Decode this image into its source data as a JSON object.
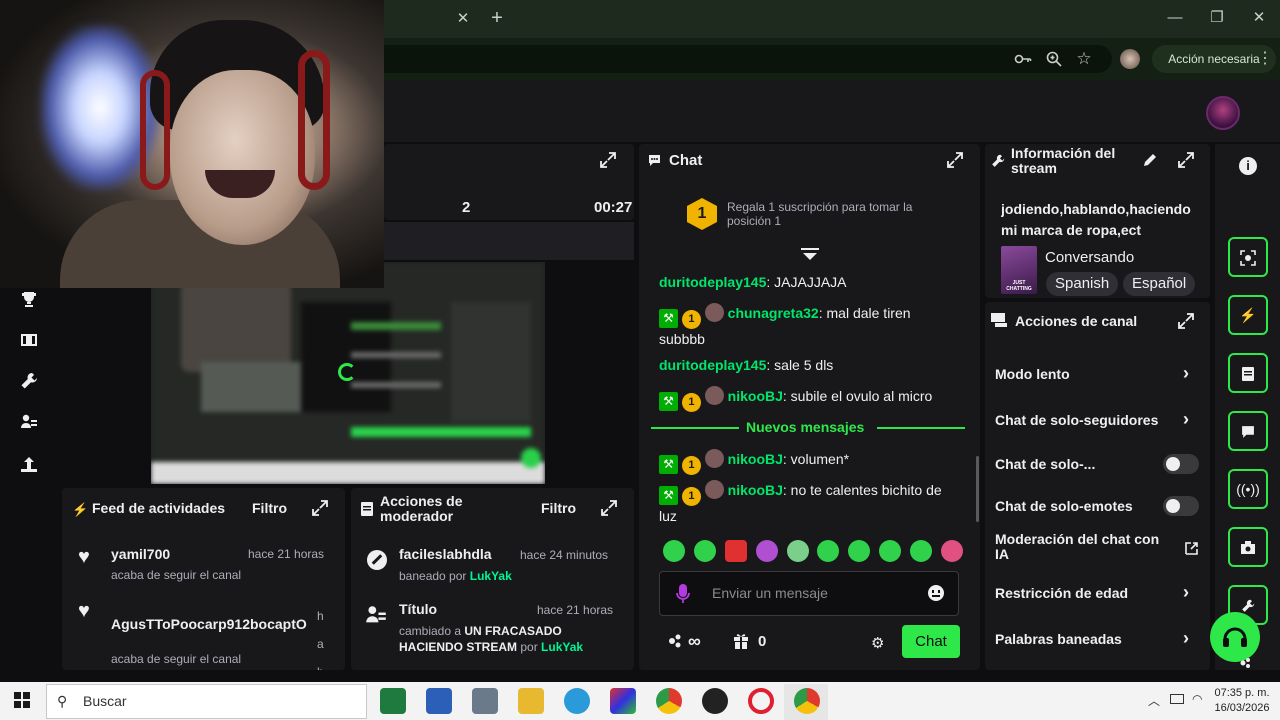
{
  "browser": {
    "action_label": "Acción necesaria",
    "tab_close": "✕",
    "new_tab": "+",
    "window_min": "—",
    "window_max": "❐",
    "window_close": "✕"
  },
  "broadcast": {
    "viewers": "2",
    "duration": "00:27"
  },
  "activity_feed": {
    "title": "Feed de actividades",
    "filter": "Filtro",
    "items": [
      {
        "user": "yamil700",
        "time": "hace 21 horas",
        "action": "acaba de seguir el canal"
      },
      {
        "user": "AgusTToPoocarp912bocaptO",
        "time": "ha ho",
        "action": "acaba de seguir el canal"
      }
    ]
  },
  "mod_actions": {
    "title": "Acciones de moderador",
    "filter": "Filtro",
    "items": [
      {
        "title": "facileslabhdla",
        "time": "hace 24 minutos",
        "desc": "baneado por",
        "by": "LukYak"
      },
      {
        "title": "Título",
        "time": "hace 21 horas",
        "desc": "cambiado a",
        "value": "UN FRACASADO HACIENDO STREAM",
        "desc2": "por",
        "by": "LukYak"
      }
    ]
  },
  "chat": {
    "title": "Chat",
    "gift_banner": "Regala 1 suscripción para tomar la posición 1",
    "gift_rank": "1",
    "messages": [
      {
        "user": "duritodeplay145",
        "text": ": JAJAJJAJA",
        "badges": false
      },
      {
        "user": "chunagreta32",
        "text": ": mal dale tiren subbbb",
        "badges": true
      },
      {
        "user": "duritodeplay145",
        "text": ": sale 5 dls",
        "badges": false
      },
      {
        "user": "nikooBJ",
        "text": ": subile el ovulo al micro",
        "badges": true
      }
    ],
    "new_messages_label": "Nuevos mensajes",
    "new_messages": [
      {
        "user": "nikooBJ",
        "text": ": volumen*",
        "badges": true
      },
      {
        "user": "nikooBJ",
        "text": ": no te calentes bichito de luz",
        "badges": true
      }
    ],
    "sub_badge": "1",
    "input_placeholder": "Enviar un mensaje",
    "points": "∞",
    "gifts_count": "0",
    "send_label": "Chat"
  },
  "stream_info": {
    "title_header": "Información del stream",
    "stream_title": "jodiendo,hablando,haciendo mi marca de ropa,ect",
    "category": "Conversando",
    "tags": [
      "Spanish",
      "Español"
    ],
    "category_art_text": "JUST CHATTING"
  },
  "channel_actions": {
    "title": "Acciones de canal",
    "items": [
      {
        "label": "Modo lento",
        "control": "chevron"
      },
      {
        "label": "Chat de solo-seguidores",
        "control": "chevron"
      },
      {
        "label": "Chat de solo-...",
        "control": "toggle"
      },
      {
        "label": "Chat de solo-emotes",
        "control": "toggle"
      },
      {
        "label": "Moderación del chat con IA",
        "control": "external"
      },
      {
        "label": "Restricción de edad",
        "control": "chevron"
      },
      {
        "label": "Palabras baneadas",
        "control": "chevron"
      }
    ]
  },
  "taskbar": {
    "search_placeholder": "Buscar",
    "time": "07:35 p. m.",
    "date": "16/03/2026"
  },
  "colors": {
    "accent_green": "#00e56a",
    "bright_green": "#2ee84a",
    "sub_gold": "#f0b400",
    "panel_bg": "#18181b",
    "page_bg": "#0e0e10"
  }
}
